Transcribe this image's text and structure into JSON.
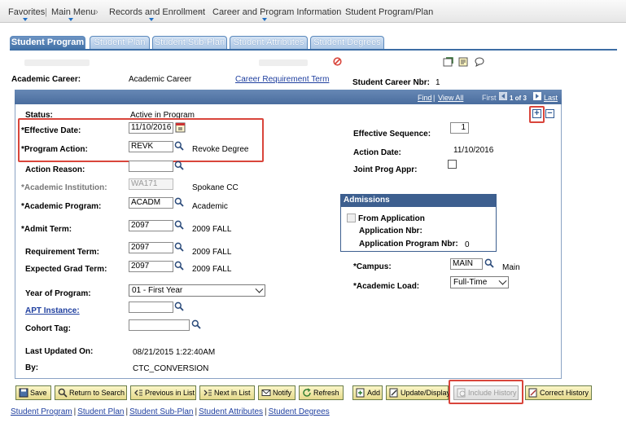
{
  "breadcrumb": [
    "Favorites",
    "Main Menu",
    "Records and Enrollment",
    "Career and Program Information",
    "Student Program/Plan"
  ],
  "tabs": [
    "Student Program",
    "Student Plan",
    "Student Sub-Plan",
    "Student Attributes",
    "Student Degrees"
  ],
  "active_tab": "Student Program",
  "header": {
    "academic_career_label": "Academic Career:",
    "academic_career_value": "Academic Career",
    "career_requirement_term": "Career Requirement Term",
    "student_career_nbr_label": "Student Career Nbr:",
    "student_career_nbr_value": "1"
  },
  "grid_header": {
    "find": "Find",
    "sep": "|",
    "view_all": "View All",
    "first": "First",
    "range": "1 of 3",
    "last": "Last"
  },
  "left": {
    "status_label": "Status:",
    "status_value": "Active in Program",
    "effective_date_label": "*Effective Date:",
    "effective_date_value": "11/10/2016",
    "program_action_label": "*Program Action:",
    "program_action_value": "REVK",
    "program_action_desc": "Revoke Degree",
    "action_reason_label": "Action Reason:",
    "action_reason_value": "",
    "academic_institution_label": "*Academic Institution:",
    "academic_institution_value": "WA171",
    "academic_institution_desc": "Spokane CC",
    "academic_program_label": "*Academic Program:",
    "academic_program_value": "ACADM",
    "academic_program_desc": "Academic",
    "admit_term_label": "*Admit Term:",
    "admit_term_value": "2097",
    "admit_term_desc": "2009 FALL",
    "requirement_term_label": "Requirement Term:",
    "requirement_term_value": "2097",
    "requirement_term_desc": "2009 FALL",
    "expected_grad_term_label": "Expected Grad Term:",
    "expected_grad_term_value": "2097",
    "expected_grad_term_desc": "2009 FALL",
    "year_of_program_label": "Year of Program:",
    "year_of_program_value": "01 - First Year",
    "apt_instance_label": "APT Instance:",
    "apt_instance_value": "",
    "cohort_tag_label": "Cohort Tag:",
    "cohort_tag_value": "",
    "last_updated_label": "Last Updated On:",
    "last_updated_value": "08/21/2015  1:22:40AM",
    "by_label": "By:",
    "by_value": "CTC_CONVERSION"
  },
  "right": {
    "effective_sequence_label": "Effective Sequence:",
    "effective_sequence_value": "1",
    "action_date_label": "Action Date:",
    "action_date_value": "11/10/2016",
    "joint_prog_label": "Joint Prog Appr:",
    "campus_label": "*Campus:",
    "campus_value": "MAIN",
    "campus_desc": "Main",
    "academic_load_label": "*Academic Load:",
    "academic_load_value": "Full-Time"
  },
  "admissions": {
    "title": "Admissions",
    "from_application": "From Application",
    "application_nbr_label": "Application Nbr:",
    "application_program_nbr_label": "Application Program Nbr:",
    "application_program_nbr_value": "0"
  },
  "buttons": {
    "save": "Save",
    "return_to_search": "Return to Search",
    "previous_in_list": "Previous in List",
    "next_in_list": "Next in List",
    "notify": "Notify",
    "refresh": "Refresh",
    "add": "Add",
    "update_display": "Update/Display",
    "include_history": "Include History",
    "correct_history": "Correct History"
  },
  "bottom_links": [
    "Student Program",
    "Student Plan",
    "Student Sub-Plan",
    "Student Attributes",
    "Student Degrees"
  ],
  "colors": {
    "tab_active": "#3d6ea5",
    "highlight": "#d9453b",
    "link": "#1f3f9f"
  }
}
